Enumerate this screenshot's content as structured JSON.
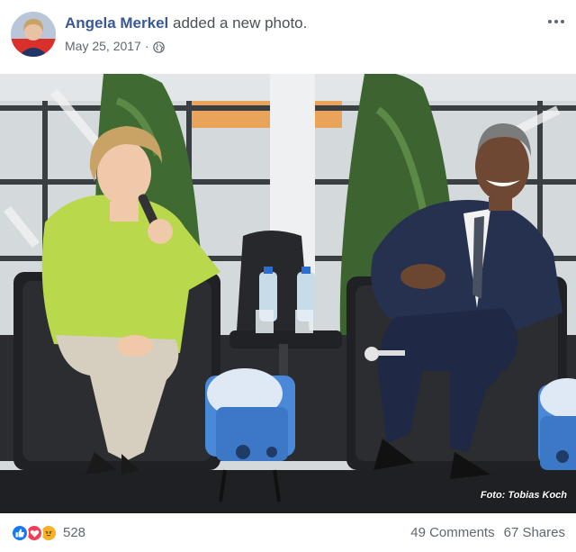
{
  "post": {
    "author": "Angela Merkel",
    "action": "added a new photo.",
    "date": "May 25, 2017",
    "separator": "·",
    "privacy_icon": "globe-icon",
    "more_icon": "more-options-icon"
  },
  "photo": {
    "credit": "Foto: Tobias Koch"
  },
  "footer": {
    "reaction_icons": [
      "like-icon",
      "love-icon",
      "angry-icon"
    ],
    "reaction_count": "528",
    "comments": "49 Comments",
    "shares": "67 Shares"
  },
  "colors": {
    "author_link": "#385898",
    "meta_text": "#616770",
    "like_blue": "#1877f2",
    "love_red": "#f33e58",
    "angry_orange": "#f7b125"
  }
}
